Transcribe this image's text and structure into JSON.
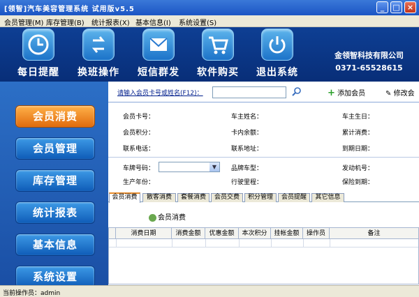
{
  "window": {
    "title": "[领智]汽车美容管理系统 试用版v5.5"
  },
  "menu": [
    "会员管理(M)",
    "库存管理(B)",
    "统计报表(X)",
    "基本信息(I)",
    "系统设置(S)"
  ],
  "toolbar": {
    "items": [
      {
        "label": "每日提醒",
        "icon": "clock-icon"
      },
      {
        "label": "换班操作",
        "icon": "swap-icon"
      },
      {
        "label": "短信群发",
        "icon": "envelope-icon"
      },
      {
        "label": "软件购买",
        "icon": "cart-icon"
      },
      {
        "label": "退出系统",
        "icon": "power-icon"
      }
    ],
    "company_name": "金领智科技有限公司",
    "company_phone": "0371-65528615"
  },
  "sidebar": [
    "会员消费",
    "会员管理",
    "库存管理",
    "统计报表",
    "基本信息",
    "系统设置"
  ],
  "search": {
    "label": "请输入会员卡号或姓名(F12)：",
    "value": "",
    "add_label": "添加会员",
    "edit_label": "修改会"
  },
  "info": {
    "card_no": "会员卡号：",
    "owner_name": "车主姓名：",
    "owner_birthday": "车主生日：",
    "points": "会员积分：",
    "card_balance": "卡内余额：",
    "total_spend": "累计消费：",
    "phone": "联系电话：",
    "address": "联系地址：",
    "expiry": "到期日期："
  },
  "car": {
    "plate": "车牌号码：",
    "brand": "品牌车型：",
    "engine": "发动机号：",
    "year": "生产年份：",
    "mileage": "行驶里程：",
    "insurance": "保险到期："
  },
  "tabs": [
    "会员消费",
    "散客消费",
    "套餐消费",
    "会员交费",
    "积分管理",
    "会员提醒",
    "其它信息"
  ],
  "sub_button": "会员消费",
  "grid": {
    "columns": [
      "消费日期",
      "消费金额",
      "优惠金额",
      "本次积分",
      "挂帐金额",
      "操作员",
      "备注"
    ]
  },
  "status": {
    "operator": "当前操作员：admin"
  }
}
